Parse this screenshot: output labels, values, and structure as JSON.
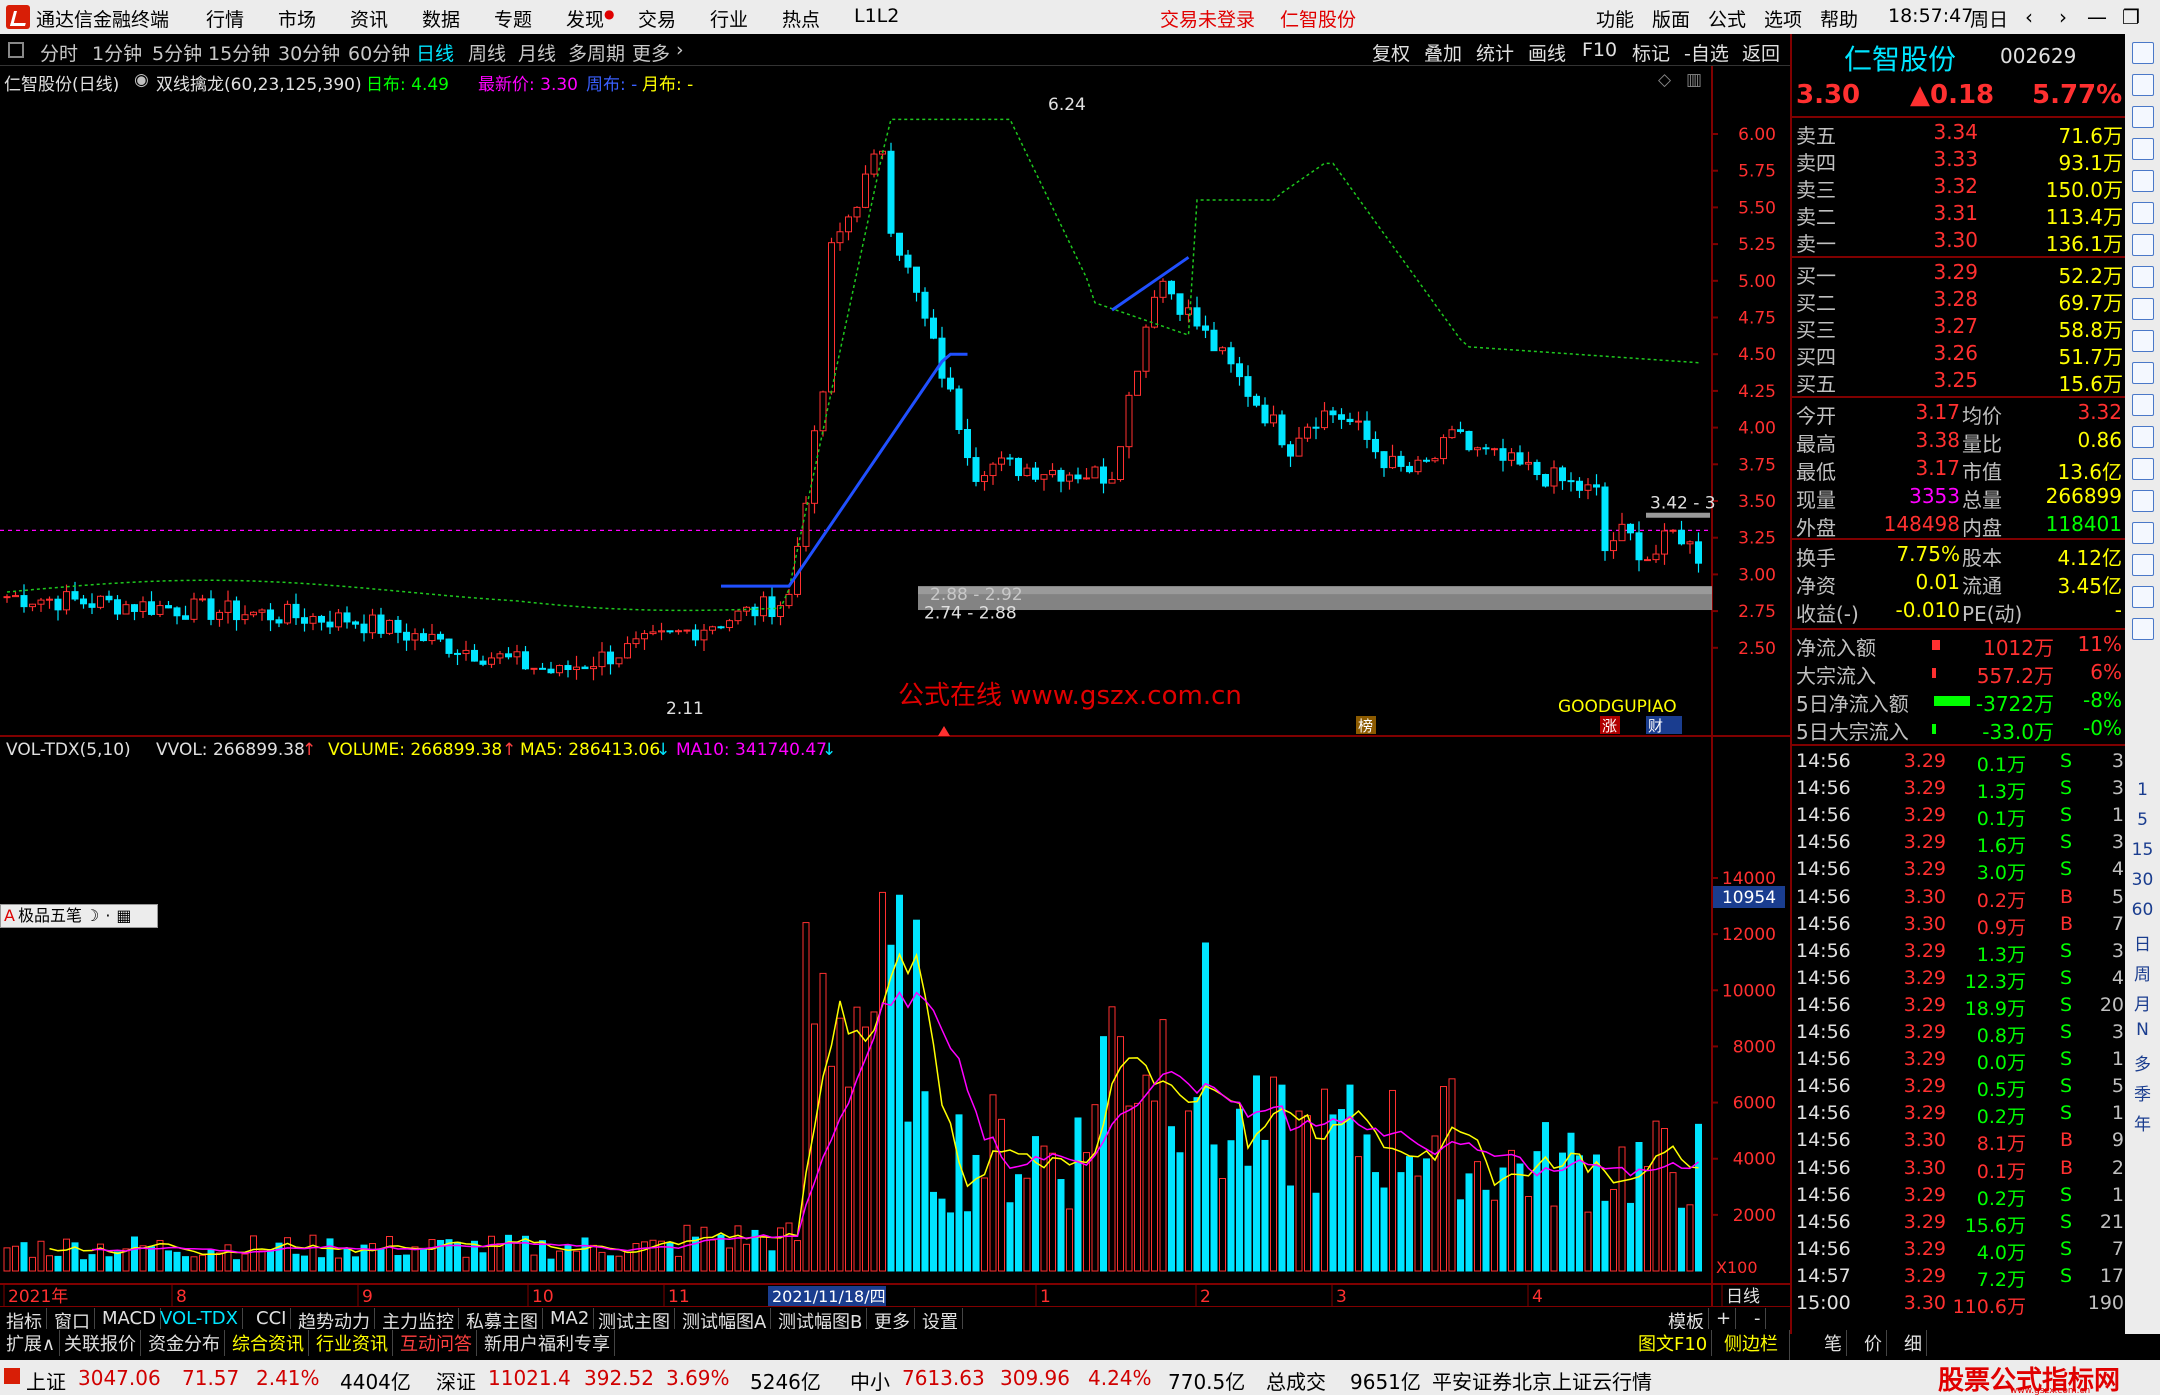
{
  "app": {
    "title": "通达信金融终端",
    "menus": [
      "行情",
      "市场",
      "资讯",
      "数据",
      "专题",
      "发现",
      "交易",
      "行业",
      "热点",
      "L1L2"
    ],
    "notice_trade": "交易未登录",
    "notice_stock": "仁智股份",
    "right_menus": [
      "功能",
      "版面",
      "公式",
      "选项",
      "帮助"
    ],
    "clock": "18:57:47",
    "weekday": "周日"
  },
  "periods": [
    "分时",
    "1分钟",
    "5分钟",
    "15分钟",
    "30分钟",
    "60分钟",
    "日线",
    "周线",
    "月线",
    "多周期",
    "更多"
  ],
  "active_period": "日线",
  "right_tools": [
    "复权",
    "叠加",
    "统计",
    "画线",
    "F10",
    "标记",
    "-自选",
    "返回"
  ],
  "main_info": {
    "name": "仁智股份(日线)",
    "indicator": "双线擒龙(60,23,125,390)",
    "day_label": "日布: 4.49",
    "latest_label": "最新价: 3.30",
    "week_label": "周布: -",
    "month_label": "月布: -"
  },
  "price_axis": [
    "6.00",
    "5.75",
    "5.50",
    "5.25",
    "5.00",
    "4.75",
    "4.50",
    "4.25",
    "4.00",
    "3.75",
    "3.50",
    "3.25",
    "3.00",
    "2.75",
    "2.50"
  ],
  "annotations": {
    "high": "6.24",
    "low": "2.11",
    "band1": "2.88 - 2.92",
    "band2": "2.74 - 2.88",
    "band3": "3.42 - 3",
    "watermark": "公式在线  www.gszx.com.cn",
    "goodgupiao": "GOODGUPIAO",
    "tag_bang": "榜",
    "tag_zhang": "涨",
    "tag_caibao": "财"
  },
  "vol_info": {
    "name": "VOL-TDX(5,10)",
    "vvol": "VVOL: 266899.38",
    "volume": "VOLUME: 266899.38",
    "ma5": "MA5: 286413.06",
    "ma10": "MA10: 341740.47"
  },
  "vol_axis": [
    "14000",
    "12000",
    "10000",
    "8000",
    "6000",
    "4000",
    "2000"
  ],
  "vol_cursor": "10954",
  "vol_unit": "X100",
  "pen_tool": "极品五笔",
  "date_axis": [
    "2021年",
    "8",
    "9",
    "10",
    "11",
    "2021/11/18/四",
    "1",
    "2",
    "3",
    "4",
    "日线"
  ],
  "quote": {
    "name": "仁智股份",
    "code": "002629",
    "price": "3.30",
    "change": "▲0.18",
    "pct": "5.77%",
    "asks": [
      {
        "label": "卖五",
        "price": "3.34",
        "vol": "71.6万"
      },
      {
        "label": "卖四",
        "price": "3.33",
        "vol": "93.1万"
      },
      {
        "label": "卖三",
        "price": "3.32",
        "vol": "150.0万"
      },
      {
        "label": "卖二",
        "price": "3.31",
        "vol": "113.4万"
      },
      {
        "label": "卖一",
        "price": "3.30",
        "vol": "136.1万"
      }
    ],
    "bids": [
      {
        "label": "买一",
        "price": "3.29",
        "vol": "52.2万"
      },
      {
        "label": "买二",
        "price": "3.28",
        "vol": "69.7万"
      },
      {
        "label": "买三",
        "price": "3.27",
        "vol": "58.8万"
      },
      {
        "label": "买四",
        "price": "3.26",
        "vol": "51.7万"
      },
      {
        "label": "买五",
        "price": "3.25",
        "vol": "15.6万"
      }
    ],
    "stats1": [
      {
        "l1": "今开",
        "v1": "3.17",
        "l2": "均价",
        "v2": "3.32"
      },
      {
        "l1": "最高",
        "v1": "3.38",
        "l2": "量比",
        "v2": "0.86"
      },
      {
        "l1": "最低",
        "v1": "3.17",
        "l2": "市值",
        "v2": "13.6亿"
      },
      {
        "l1": "现量",
        "v1": "3353",
        "l2": "总量",
        "v2": "266899"
      },
      {
        "l1": "外盘",
        "v1": "148498",
        "l2": "内盘",
        "v2": "118401"
      }
    ],
    "stats2": [
      {
        "l1": "换手",
        "v1": "7.75%",
        "l2": "股本",
        "v2": "4.12亿"
      },
      {
        "l1": "净资",
        "v1": "0.01",
        "l2": "流通",
        "v2": "3.45亿"
      },
      {
        "l1": "收益(-)",
        "v1": "-0.010",
        "l2": "PE(动)",
        "v2": "-"
      }
    ],
    "flows": [
      {
        "label": "净流入额",
        "value": "1012万",
        "pct": "11%"
      },
      {
        "label": "大宗流入",
        "value": "557.2万",
        "pct": "6%"
      },
      {
        "label": "5日净流入额",
        "value": "-3722万",
        "pct": "-8%"
      },
      {
        "label": "5日大宗流入",
        "value": "-33.0万",
        "pct": "-0%"
      }
    ],
    "ticks": [
      {
        "t": "14:56",
        "p": "3.29",
        "v": "0.1万",
        "s": "S",
        "n": "3"
      },
      {
        "t": "14:56",
        "p": "3.29",
        "v": "1.3万",
        "s": "S",
        "n": "3"
      },
      {
        "t": "14:56",
        "p": "3.29",
        "v": "0.1万",
        "s": "S",
        "n": "1"
      },
      {
        "t": "14:56",
        "p": "3.29",
        "v": "1.6万",
        "s": "S",
        "n": "3"
      },
      {
        "t": "14:56",
        "p": "3.29",
        "v": "3.0万",
        "s": "S",
        "n": "4"
      },
      {
        "t": "14:56",
        "p": "3.30",
        "v": "0.2万",
        "s": "B",
        "n": "5"
      },
      {
        "t": "14:56",
        "p": "3.30",
        "v": "0.9万",
        "s": "B",
        "n": "7"
      },
      {
        "t": "14:56",
        "p": "3.29",
        "v": "1.3万",
        "s": "S",
        "n": "3"
      },
      {
        "t": "14:56",
        "p": "3.29",
        "v": "12.3万",
        "s": "S",
        "n": "4"
      },
      {
        "t": "14:56",
        "p": "3.29",
        "v": "18.9万",
        "s": "S",
        "n": "20"
      },
      {
        "t": "14:56",
        "p": "3.29",
        "v": "0.8万",
        "s": "S",
        "n": "3"
      },
      {
        "t": "14:56",
        "p": "3.29",
        "v": "0.0万",
        "s": "S",
        "n": "1"
      },
      {
        "t": "14:56",
        "p": "3.29",
        "v": "0.5万",
        "s": "S",
        "n": "5"
      },
      {
        "t": "14:56",
        "p": "3.29",
        "v": "0.2万",
        "s": "S",
        "n": "1"
      },
      {
        "t": "14:56",
        "p": "3.30",
        "v": "8.1万",
        "s": "B",
        "n": "9"
      },
      {
        "t": "14:56",
        "p": "3.30",
        "v": "0.1万",
        "s": "B",
        "n": "2"
      },
      {
        "t": "14:56",
        "p": "3.29",
        "v": "0.2万",
        "s": "S",
        "n": "1"
      },
      {
        "t": "14:56",
        "p": "3.29",
        "v": "15.6万",
        "s": "S",
        "n": "21"
      },
      {
        "t": "14:56",
        "p": "3.29",
        "v": "4.0万",
        "s": "S",
        "n": "7"
      },
      {
        "t": "14:57",
        "p": "3.29",
        "v": "7.2万",
        "s": "S",
        "n": "17"
      },
      {
        "t": "15:00",
        "p": "3.30",
        "v": "110.6万",
        "s": "",
        "n": "190"
      }
    ]
  },
  "sidebar_text": [
    "1",
    "5",
    "15",
    "30",
    "60",
    "日",
    "周",
    "月",
    "N",
    "多",
    "季",
    "年"
  ],
  "tabs_row1": [
    "指标",
    "窗口",
    "MACD",
    "VOL-TDX",
    "CCI",
    "趋势动力",
    "主力监控",
    "私募主图",
    "MA2",
    "测试主图",
    "测试幅图A",
    "测试幅图B",
    "更多",
    "设置"
  ],
  "tabs_row1_right": [
    "模板",
    "+",
    "-"
  ],
  "tabs_row2": [
    "扩展∧",
    "关联报价",
    "资金分布",
    "综合资讯",
    "行业资讯",
    "互动问答",
    "新用户福利专享"
  ],
  "tabs_row2_right": [
    "图文F10",
    "侧边栏《",
    "笔",
    "价",
    "细"
  ],
  "status": {
    "sh_label": "上证",
    "sh_val": "3047.06",
    "sh_chg": "71.57",
    "sh_pct": "2.41%",
    "sh_amt": "4404亿",
    "sz_label": "深证",
    "sz_val": "11021.4",
    "sz_chg": "392.52",
    "sz_pct": "3.69%",
    "sz_amt": "5246亿",
    "zx_label": "中小",
    "zx_val": "7613.63",
    "zx_chg": "309.96",
    "zx_pct": "4.24%",
    "zx_amt": "770.5亿",
    "total_label": "总成交",
    "total_val": "9651亿",
    "broker": "平安证券北京上证云行情",
    "brand": "股票公式指标网",
    "brand_url": "www.gszx.com.cn"
  }
}
